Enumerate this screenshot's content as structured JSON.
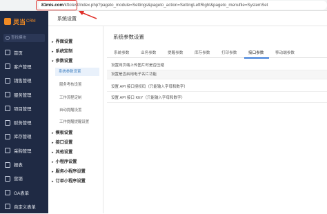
{
  "browser": {
    "url_host": "81mis.com",
    "url_path": "/kftotest/",
    "url_rest": "index.php?pageto_module=Settings&pageto_action=SettingLeftRight&pageto_menufile=SystemSet"
  },
  "sidebar": {
    "logo_text": "灵当",
    "logo_crm": "CRM",
    "search_placeholder": "查找模块",
    "items": [
      {
        "label": "首页",
        "icon": "home-icon"
      },
      {
        "label": "客户管理",
        "icon": "user-icon"
      },
      {
        "label": "销售管理",
        "icon": "sales-icon"
      },
      {
        "label": "服务管理",
        "icon": "service-icon"
      },
      {
        "label": "项目管理",
        "icon": "project-icon"
      },
      {
        "label": "财务管理",
        "icon": "finance-icon"
      },
      {
        "label": "库存管理",
        "icon": "inventory-icon"
      },
      {
        "label": "采购管理",
        "icon": "purchase-icon"
      },
      {
        "label": "报表",
        "icon": "report-icon"
      },
      {
        "label": "营销",
        "icon": "marketing-icon"
      },
      {
        "label": "OA表单",
        "icon": "form-icon"
      },
      {
        "label": "自定义表单",
        "icon": "custom-form-icon"
      }
    ]
  },
  "header": {
    "title": "系统设置"
  },
  "nav": {
    "items": [
      {
        "label": "界面设置"
      },
      {
        "label": "系统定制"
      },
      {
        "label": "参数设置"
      },
      {
        "label": "模板设置"
      },
      {
        "label": "接口设置"
      },
      {
        "label": "其他设置"
      },
      {
        "label": "小程序设置"
      },
      {
        "label": "服务小程序设置"
      },
      {
        "label": "订单小程序设置"
      }
    ],
    "sub_items": [
      {
        "label": "系统参数设置"
      },
      {
        "label": "服务考核设置"
      },
      {
        "label": "工作流程定制"
      },
      {
        "label": "自动提醒设置"
      },
      {
        "label": "工作提醒提醒设置"
      }
    ]
  },
  "main": {
    "title": "系统参数设置",
    "tabs": [
      {
        "label": "系统参数"
      },
      {
        "label": "业务参数"
      },
      {
        "label": "提醒参数"
      },
      {
        "label": "库存参数"
      },
      {
        "label": "打印参数"
      },
      {
        "label": "接口参数"
      },
      {
        "label": "移动端参数"
      }
    ],
    "active_tab": "接口参数",
    "rows": [
      {
        "label": "设置网页端上传图片时是否压缩"
      },
      {
        "label": "设置是否启用电子名片功能"
      },
      {
        "label": "设置 API 接口授权码（只能输入字母和数字）"
      },
      {
        "label": "设置 API 接口 KEY（只能输入字母和数字）"
      }
    ]
  },
  "colors": {
    "sidebar_bg": "#1f2a44",
    "brand": "#f08a24",
    "accent": "#3f7fd9",
    "highlight": "#e0312b"
  }
}
